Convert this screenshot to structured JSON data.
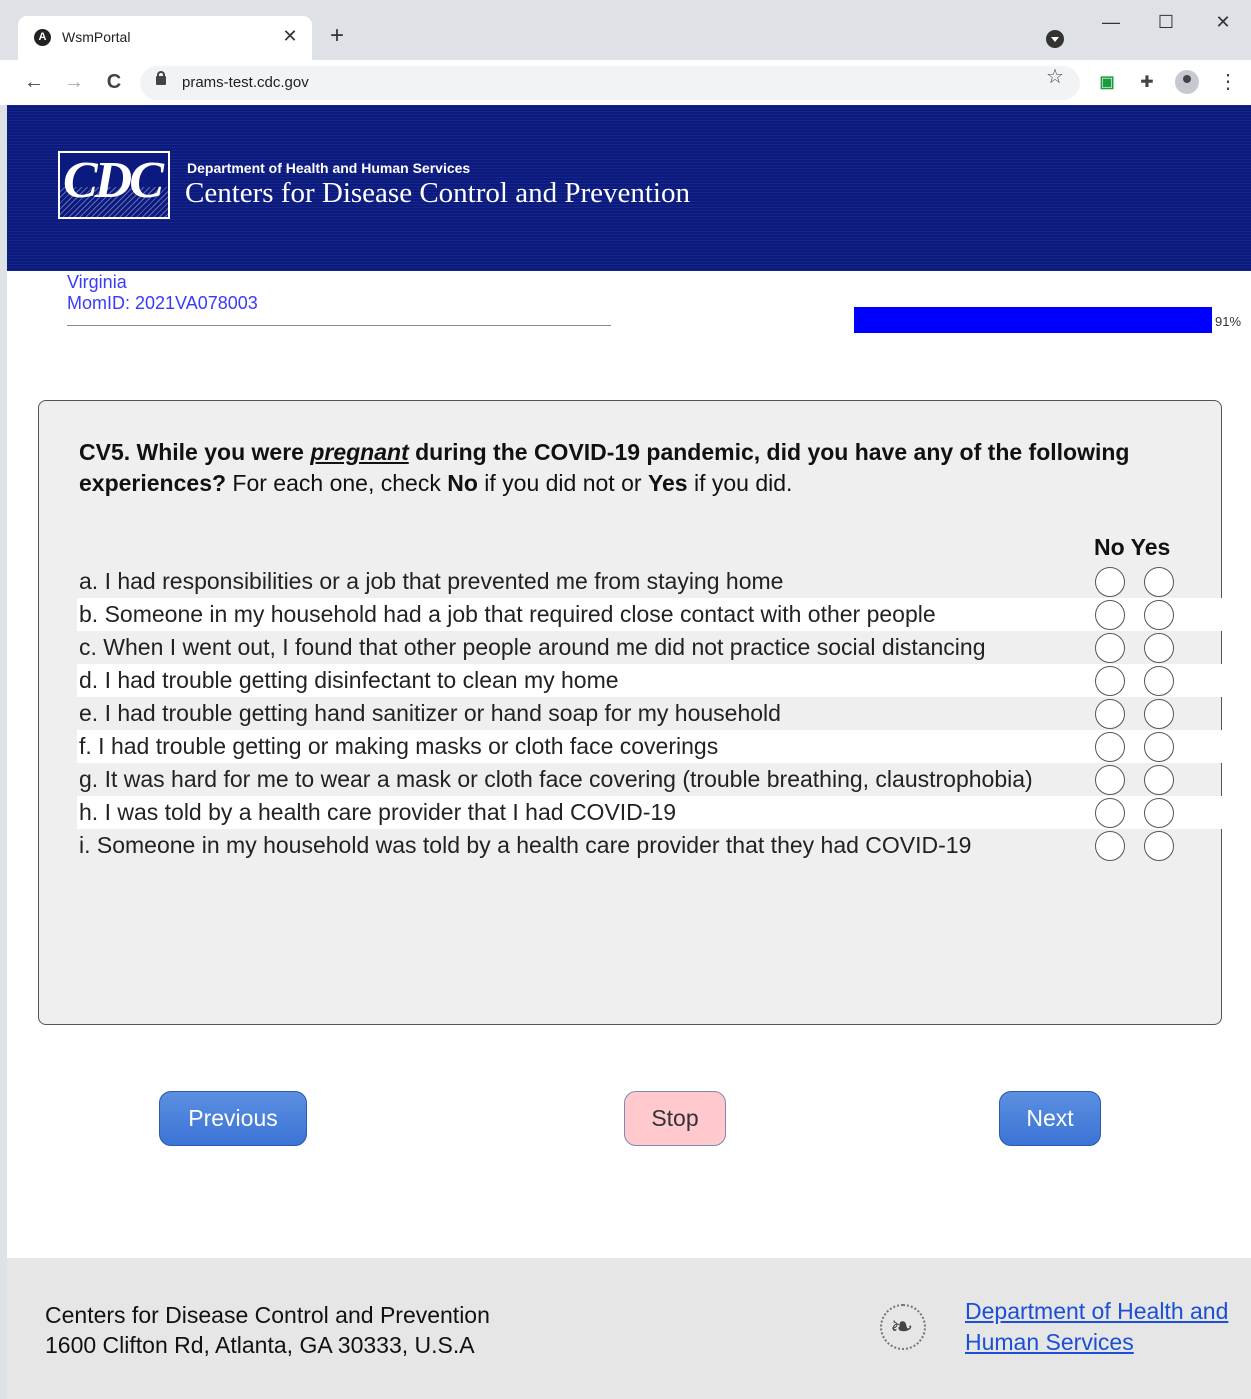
{
  "browser": {
    "tab_title": "WsmPortal",
    "tab_close": "✕",
    "new_tab": "+",
    "url": "prams-test.cdc.gov",
    "minimize": "—",
    "maximize": "☐",
    "close": "✕",
    "back": "←",
    "forward": "→",
    "reload": "C",
    "star": "☆",
    "kebab": "⋮"
  },
  "header": {
    "logo_text": "CDC",
    "department": "Department of Health and Human Services",
    "agency": "Centers for Disease Control and Prevention",
    "brand_color": "#0b1a7e"
  },
  "meta": {
    "state": "Virginia",
    "mom_id": "MomID: 2021VA078003",
    "progress_percent": 91,
    "progress_label": "91%"
  },
  "question": {
    "id_and_text_1": "CV5. While you were ",
    "emphasis": "pregnant",
    "id_and_text_2": " during the COVID-19 pandemic, did you have any of the following experiences?",
    "instruction_1": " For each one, check ",
    "no_word": "No",
    "instruction_2": " if you did not or ",
    "yes_word": "Yes",
    "instruction_3": " if you did.",
    "col_no": "No",
    "col_yes": "Yes",
    "items": [
      {
        "text": "a. I had responsibilities or a job that prevented me from staying home"
      },
      {
        "text": "b. Someone in my household had a job that required close contact with other people"
      },
      {
        "text": "c. When I went out, I found that other people around me did not practice social distancing"
      },
      {
        "text": "d. I had trouble getting disinfectant to clean my home"
      },
      {
        "text": "e. I had trouble getting hand sanitizer or hand soap for my household"
      },
      {
        "text": "f. I had trouble getting or making masks or cloth face coverings"
      },
      {
        "text": "g. It was hard for me to wear a mask or cloth face covering (trouble breathing, claustrophobia)"
      },
      {
        "text": "h. I was told by a health care provider that I had COVID-19"
      },
      {
        "text": "i. Someone in my household was told by a health care provider that they had COVID-19"
      }
    ]
  },
  "buttons": {
    "previous": "Previous",
    "stop": "Stop",
    "next": "Next"
  },
  "footer": {
    "org_name": "Centers for Disease Control and Prevention",
    "address": "1600 Clifton Rd, Atlanta, GA 30333, U.S.A",
    "hhs_link": "Department of Health and Human Services"
  }
}
